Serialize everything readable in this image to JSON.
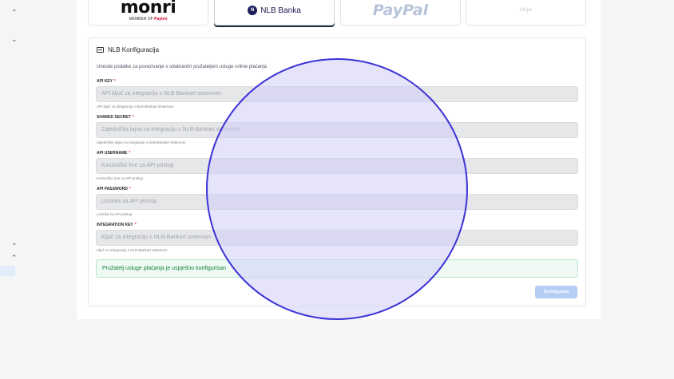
{
  "sidebar": {
    "chevrons": [
      "chevron-down",
      "chevron-down",
      "chevron-down",
      "chevron-up"
    ]
  },
  "providers": {
    "monri": {
      "logo_text": "monri",
      "sub_prefix": "MEMBER OF ",
      "sub_brand": "Payten"
    },
    "nlb": {
      "label": "NLB Banka",
      "icon_text": "N"
    },
    "paypal": {
      "label": "PayPal"
    },
    "stripe": {
      "label": "Stripe"
    }
  },
  "config": {
    "title": "NLB Konfiguracija",
    "description": "Unesite podatke za povezivanje s odabranim pružateljem usluge online plaćanja",
    "required_mark": "*",
    "fields": [
      {
        "label": "API KEY",
        "placeholder": "API ključ za integraciju s NLB-Bankart sistemom",
        "hint": "API ključ za integraciju s NLB-Bankart sistemom"
      },
      {
        "label": "SHARED SECRET",
        "placeholder": "Zajednička tajna za integraciju s NLB-Bankart sistemom",
        "hint": "Zajednička tajna za integraciju s NLB-Bankart sistemom"
      },
      {
        "label": "API USERNAME",
        "placeholder": "Korisničko ime za API pristup",
        "hint": "Korisničko ime za API pristup"
      },
      {
        "label": "API PASSWORD",
        "placeholder": "Lozinka za API pristup",
        "hint": "Lozinka za API pristup"
      },
      {
        "label": "INTEGRATION KEY",
        "placeholder": "Ključ za integraciju s NLB-Bankart sistemom",
        "hint": "Ključ za integraciju s NLB-Bankart sistemom"
      }
    ],
    "success_message": "Pružatelj usluge plaćanja je uspješno konfigurisan",
    "submit_label": "Konfiguriraj"
  },
  "colors": {
    "accent": "#3b33d6",
    "success_text": "#15803d",
    "button_disabled": "#b4cdf3"
  }
}
